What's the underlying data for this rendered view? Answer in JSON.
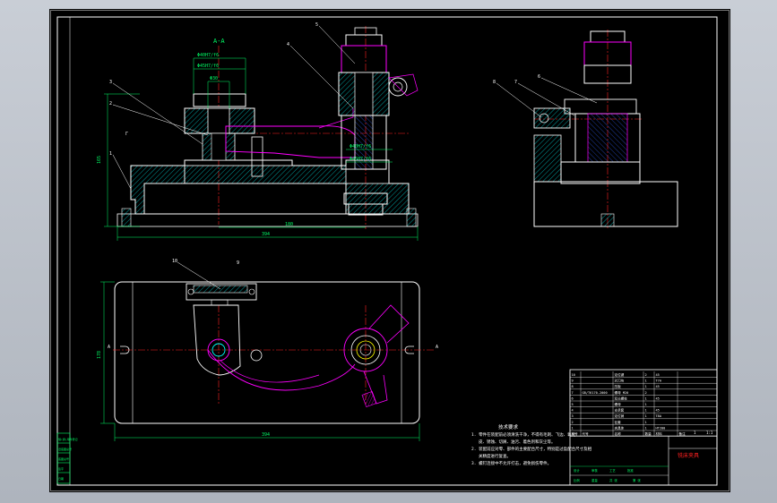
{
  "colors": {
    "background": "#000000",
    "frame": "#ffffff",
    "outline": "#ffffff",
    "hatch": "#00ffff",
    "center": "#ff2020",
    "dimension": "#00ff66",
    "part": "#ff00ff",
    "blue": "#3060ff",
    "yellow": "#ffff00"
  },
  "section_label": "A-A",
  "fits": {
    "f1": "Φ40H7/f6",
    "f2": "Φ45H7/f6",
    "f3": "Φ30",
    "f4": "Φ40H7/f6",
    "f5": "Φ45H7/f6"
  },
  "dims": {
    "front_height": "165",
    "front_mid": "180",
    "front_total": "394",
    "plan_total": "394",
    "plan_height": "178"
  },
  "balloons": {
    "front": [
      "5",
      "4",
      "3",
      "2",
      "1"
    ],
    "side": [
      "8",
      "7",
      "6"
    ],
    "plan": [
      "10",
      "9"
    ]
  },
  "view_marks": {
    "a_left": "A",
    "a_right": "A",
    "side_mark": "Γ"
  },
  "notes": {
    "title": "技术要求",
    "lines": [
      "1. 零件在装配前必须清洗干净，不得有毛刺、飞边、氧化",
      "皮、锈蚀、切屑、油污、着色剂和灰尘等。",
      "2. 装配前应对零、部件的主要配合尺寸，特别是过盈配合尺寸及相",
      "关精度进行复查。",
      "3. 螺钉连接中不允许打击，避免损伤零件。"
    ]
  },
  "title_block": {
    "name": "铣床夹具",
    "headers": [
      "序号",
      "代号",
      "名称",
      "数量",
      "材料",
      "备注"
    ],
    "rows": [
      [
        "10",
        "",
        "定位键",
        "2",
        "45",
        ""
      ],
      [
        "9",
        "",
        "对刀块",
        "1",
        "T7A",
        ""
      ],
      [
        "8",
        "",
        "压板",
        "1",
        "45",
        ""
      ],
      [
        "7",
        "GB/T6170-2000",
        "螺母 M20",
        "2",
        "",
        ""
      ],
      [
        "6",
        "",
        "双头螺柱",
        "1",
        "45",
        ""
      ],
      [
        "5",
        "",
        "螺母",
        "1",
        "",
        ""
      ],
      [
        "4",
        "",
        "支承套",
        "1",
        "45",
        ""
      ],
      [
        "3",
        "",
        "定位销",
        "1",
        "T8A",
        ""
      ],
      [
        "2",
        "",
        "钻套",
        "1",
        "",
        ""
      ],
      [
        "1",
        "",
        "夹具体",
        "1",
        "HT200",
        ""
      ]
    ],
    "scale": "1:1",
    "sheet": "1",
    "labels": [
      "设计",
      "审核",
      "工艺",
      "批准",
      "比例",
      "重量",
      "共 张",
      "第 张"
    ]
  },
  "side_strip": [
    "借(通)用件登记",
    "旧底图总号",
    "底图总号",
    "签字",
    "日期"
  ]
}
